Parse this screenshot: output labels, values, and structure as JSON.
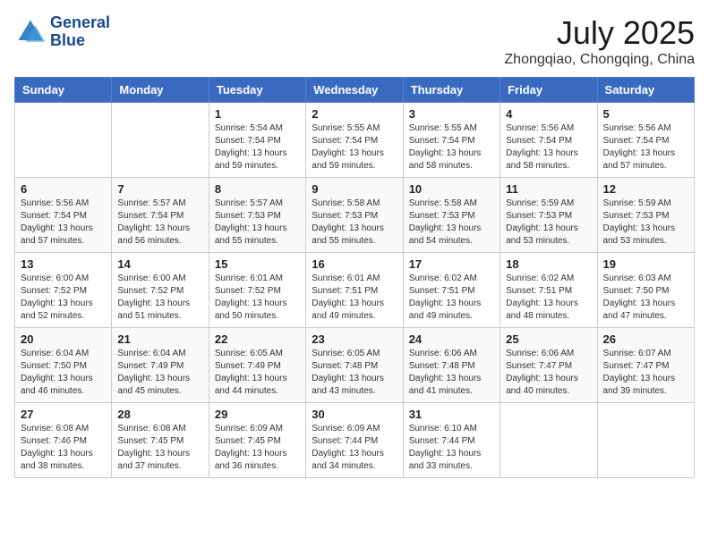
{
  "header": {
    "logo_line1": "General",
    "logo_line2": "Blue",
    "main_title": "July 2025",
    "subtitle": "Zhongqiao, Chongqing, China"
  },
  "calendar": {
    "days_of_week": [
      "Sunday",
      "Monday",
      "Tuesday",
      "Wednesday",
      "Thursday",
      "Friday",
      "Saturday"
    ],
    "weeks": [
      [
        {
          "day": "",
          "info": ""
        },
        {
          "day": "",
          "info": ""
        },
        {
          "day": "1",
          "info": "Sunrise: 5:54 AM\nSunset: 7:54 PM\nDaylight: 13 hours and 59 minutes."
        },
        {
          "day": "2",
          "info": "Sunrise: 5:55 AM\nSunset: 7:54 PM\nDaylight: 13 hours and 59 minutes."
        },
        {
          "day": "3",
          "info": "Sunrise: 5:55 AM\nSunset: 7:54 PM\nDaylight: 13 hours and 58 minutes."
        },
        {
          "day": "4",
          "info": "Sunrise: 5:56 AM\nSunset: 7:54 PM\nDaylight: 13 hours and 58 minutes."
        },
        {
          "day": "5",
          "info": "Sunrise: 5:56 AM\nSunset: 7:54 PM\nDaylight: 13 hours and 57 minutes."
        }
      ],
      [
        {
          "day": "6",
          "info": "Sunrise: 5:56 AM\nSunset: 7:54 PM\nDaylight: 13 hours and 57 minutes."
        },
        {
          "day": "7",
          "info": "Sunrise: 5:57 AM\nSunset: 7:54 PM\nDaylight: 13 hours and 56 minutes."
        },
        {
          "day": "8",
          "info": "Sunrise: 5:57 AM\nSunset: 7:53 PM\nDaylight: 13 hours and 55 minutes."
        },
        {
          "day": "9",
          "info": "Sunrise: 5:58 AM\nSunset: 7:53 PM\nDaylight: 13 hours and 55 minutes."
        },
        {
          "day": "10",
          "info": "Sunrise: 5:58 AM\nSunset: 7:53 PM\nDaylight: 13 hours and 54 minutes."
        },
        {
          "day": "11",
          "info": "Sunrise: 5:59 AM\nSunset: 7:53 PM\nDaylight: 13 hours and 53 minutes."
        },
        {
          "day": "12",
          "info": "Sunrise: 5:59 AM\nSunset: 7:53 PM\nDaylight: 13 hours and 53 minutes."
        }
      ],
      [
        {
          "day": "13",
          "info": "Sunrise: 6:00 AM\nSunset: 7:52 PM\nDaylight: 13 hours and 52 minutes."
        },
        {
          "day": "14",
          "info": "Sunrise: 6:00 AM\nSunset: 7:52 PM\nDaylight: 13 hours and 51 minutes."
        },
        {
          "day": "15",
          "info": "Sunrise: 6:01 AM\nSunset: 7:52 PM\nDaylight: 13 hours and 50 minutes."
        },
        {
          "day": "16",
          "info": "Sunrise: 6:01 AM\nSunset: 7:51 PM\nDaylight: 13 hours and 49 minutes."
        },
        {
          "day": "17",
          "info": "Sunrise: 6:02 AM\nSunset: 7:51 PM\nDaylight: 13 hours and 49 minutes."
        },
        {
          "day": "18",
          "info": "Sunrise: 6:02 AM\nSunset: 7:51 PM\nDaylight: 13 hours and 48 minutes."
        },
        {
          "day": "19",
          "info": "Sunrise: 6:03 AM\nSunset: 7:50 PM\nDaylight: 13 hours and 47 minutes."
        }
      ],
      [
        {
          "day": "20",
          "info": "Sunrise: 6:04 AM\nSunset: 7:50 PM\nDaylight: 13 hours and 46 minutes."
        },
        {
          "day": "21",
          "info": "Sunrise: 6:04 AM\nSunset: 7:49 PM\nDaylight: 13 hours and 45 minutes."
        },
        {
          "day": "22",
          "info": "Sunrise: 6:05 AM\nSunset: 7:49 PM\nDaylight: 13 hours and 44 minutes."
        },
        {
          "day": "23",
          "info": "Sunrise: 6:05 AM\nSunset: 7:48 PM\nDaylight: 13 hours and 43 minutes."
        },
        {
          "day": "24",
          "info": "Sunrise: 6:06 AM\nSunset: 7:48 PM\nDaylight: 13 hours and 41 minutes."
        },
        {
          "day": "25",
          "info": "Sunrise: 6:06 AM\nSunset: 7:47 PM\nDaylight: 13 hours and 40 minutes."
        },
        {
          "day": "26",
          "info": "Sunrise: 6:07 AM\nSunset: 7:47 PM\nDaylight: 13 hours and 39 minutes."
        }
      ],
      [
        {
          "day": "27",
          "info": "Sunrise: 6:08 AM\nSunset: 7:46 PM\nDaylight: 13 hours and 38 minutes."
        },
        {
          "day": "28",
          "info": "Sunrise: 6:08 AM\nSunset: 7:45 PM\nDaylight: 13 hours and 37 minutes."
        },
        {
          "day": "29",
          "info": "Sunrise: 6:09 AM\nSunset: 7:45 PM\nDaylight: 13 hours and 36 minutes."
        },
        {
          "day": "30",
          "info": "Sunrise: 6:09 AM\nSunset: 7:44 PM\nDaylight: 13 hours and 34 minutes."
        },
        {
          "day": "31",
          "info": "Sunrise: 6:10 AM\nSunset: 7:44 PM\nDaylight: 13 hours and 33 minutes."
        },
        {
          "day": "",
          "info": ""
        },
        {
          "day": "",
          "info": ""
        }
      ]
    ]
  }
}
